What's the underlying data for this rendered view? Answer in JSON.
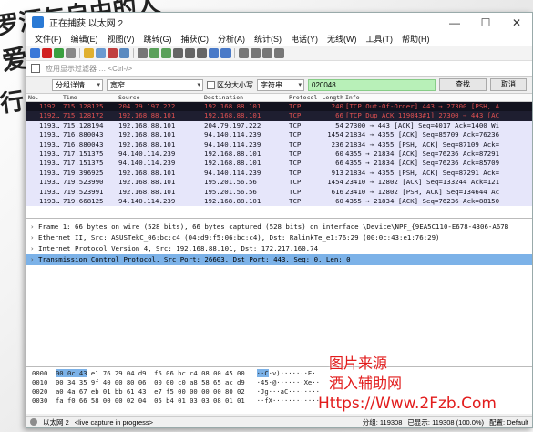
{
  "window": {
    "title": "正在捕获 以太网 2",
    "controls": {
      "minimize": "—",
      "maximize": "☐",
      "close": "✕"
    }
  },
  "background_text": {
    "line1": "罗漂与自由的人",
    "line2": "爱",
    "line3": "行"
  },
  "menu": [
    "文件(F)",
    "编辑(E)",
    "视图(V)",
    "跳转(G)",
    "捕获(C)",
    "分析(A)",
    "统计(S)",
    "电话(Y)",
    "无线(W)",
    "工具(T)",
    "帮助(H)"
  ],
  "filter": {
    "placeholder": "应用显示过滤器 … <Ctrl-/>"
  },
  "search": {
    "mode": "分组详情",
    "charset": "宽窄",
    "case_label": "区分大小写",
    "type": "字符串",
    "value": "020048",
    "find_label": "查找",
    "cancel_label": "取消"
  },
  "columns": [
    "No.",
    "Time",
    "Source",
    "Destination",
    "Protocol",
    "Length",
    "Info"
  ],
  "packets": [
    {
      "no": "1192…",
      "time": "715.128125",
      "src": "204.79.197.222",
      "dst": "192.168.88.101",
      "proto": "TCP",
      "len": "240",
      "info": "[TCP Out-Of-Order] 443 → 27300 [PSH, A",
      "style": "dark"
    },
    {
      "no": "1192…",
      "time": "715.128172",
      "src": "192.168.88.101",
      "dst": "192.168.88.101",
      "proto": "TCP",
      "len": "66",
      "info": "[TCP Dup ACK 119043#1] 27300 → 443 [AC",
      "style": "dark"
    },
    {
      "no": "1193…",
      "time": "715.128194",
      "src": "192.168.88.101",
      "dst": "204.79.197.222",
      "proto": "TCP",
      "len": "54",
      "info": "27300 → 443 [ACK] Seq=4017 Ack=1400 Wi",
      "style": "tcp"
    },
    {
      "no": "1193…",
      "time": "716.880043",
      "src": "192.168.88.101",
      "dst": "94.140.114.239",
      "proto": "TCP",
      "len": "1454",
      "info": "21834 → 4355 [ACK] Seq=85709 Ack=76236",
      "style": "tcp"
    },
    {
      "no": "1193…",
      "time": "716.880043",
      "src": "192.168.88.101",
      "dst": "94.140.114.239",
      "proto": "TCP",
      "len": "236",
      "info": "21834 → 4355 [PSH, ACK] Seq=87109 Ack=",
      "style": "tcp"
    },
    {
      "no": "1193…",
      "time": "717.151375",
      "src": "94.140.114.239",
      "dst": "192.168.88.101",
      "proto": "TCP",
      "len": "60",
      "info": "4355 → 21834 [ACK] Seq=76236 Ack=87291",
      "style": "tcp"
    },
    {
      "no": "1193…",
      "time": "717.151375",
      "src": "94.140.114.239",
      "dst": "192.168.88.101",
      "proto": "TCP",
      "len": "66",
      "info": "4355 → 21834 [ACK] Seq=76236 Ack=85709",
      "style": "tcp"
    },
    {
      "no": "1193…",
      "time": "719.396925",
      "src": "192.168.88.101",
      "dst": "94.140.114.239",
      "proto": "TCP",
      "len": "913",
      "info": "21834 → 4355 [PSH, ACK] Seq=87291 Ack=",
      "style": "tcp"
    },
    {
      "no": "1193…",
      "time": "719.523990",
      "src": "192.168.88.101",
      "dst": "195.201.56.56",
      "proto": "TCP",
      "len": "1454",
      "info": "23410 → 12802 [ACK] Seq=133244 Ack=121",
      "style": "tcp"
    },
    {
      "no": "1193…",
      "time": "719.523991",
      "src": "192.168.88.101",
      "dst": "195.201.56.56",
      "proto": "TCP",
      "len": "616",
      "info": "23410 → 12802 [PSH, ACK] Seq=134644 Ac",
      "style": "tcp"
    },
    {
      "no": "1193…",
      "time": "719.668125",
      "src": "94.140.114.239",
      "dst": "192.168.88.101",
      "proto": "TCP",
      "len": "60",
      "info": "4355 → 21834 [ACK] Seq=76236 Ack=88150",
      "style": "tcp"
    }
  ],
  "details": [
    {
      "text": "Frame 1: 66 bytes on wire (528 bits), 66 bytes captured (528 bits) on interface \\Device\\NPF_{9EA5C110-E678-4306-A67B",
      "selected": false
    },
    {
      "text": "Ethernet II, Src: ASUSTekC_06:bc:c4 (04:d9:f5:06:bc:c4), Dst: RalinkTe_e1:76:29 (00:0c:43:e1:76:29)",
      "selected": false
    },
    {
      "text": "Internet Protocol Version 4, Src: 192.168.88.101, Dst: 172.217.160.74",
      "selected": false
    },
    {
      "text": "Transmission Control Protocol, Src Port: 26603, Dst Port: 443, Seq: 0, Len: 0",
      "selected": true
    }
  ],
  "bytes": [
    {
      "offset": "0000",
      "hl": "00 0c 43",
      "hex": " e1 76 29 04 d9  f5 06 bc c4 08 00 45 00",
      "ascii_hl": "··C",
      "ascii": "·v)·······E·"
    },
    {
      "offset": "0010",
      "hl": "",
      "hex": "00 34 35 9f 40 00 80 06  00 00 c0 a8 58 65 ac d9",
      "ascii_hl": "",
      "ascii": "·45·@·······Xe··"
    },
    {
      "offset": "0020",
      "hl": "",
      "hex": "a0 4a 67 eb 01 bb 61 43  e7 f5 00 00 00 00 80 02",
      "ascii_hl": "",
      "ascii": "·Jg···aC········"
    },
    {
      "offset": "0030",
      "hl": "",
      "hex": "fa f0 66 58 00 00 02 04  05 b4 01 03 03 08 01 01",
      "ascii_hl": "",
      "ascii": "··fX············"
    }
  ],
  "status": {
    "iface": "以太网 2",
    "capture": "<live capture in progress>",
    "packets": "分组: 119308",
    "displayed": "已显示: 119308 (100.0%)",
    "profile": "配置: Default"
  },
  "watermark": {
    "line1": "图片来源",
    "line2": "酒入辅助网",
    "line3": "Https://Www.2Fzb.Com"
  },
  "colors": {
    "dark_row_bg": "#12121e",
    "dark_row_fg": "#e05050",
    "tcp_row_bg": "#e6e6fa",
    "selection": "#7cb2e8",
    "search_bg": "#b8f0b8",
    "watermark": "#e21c1c"
  }
}
